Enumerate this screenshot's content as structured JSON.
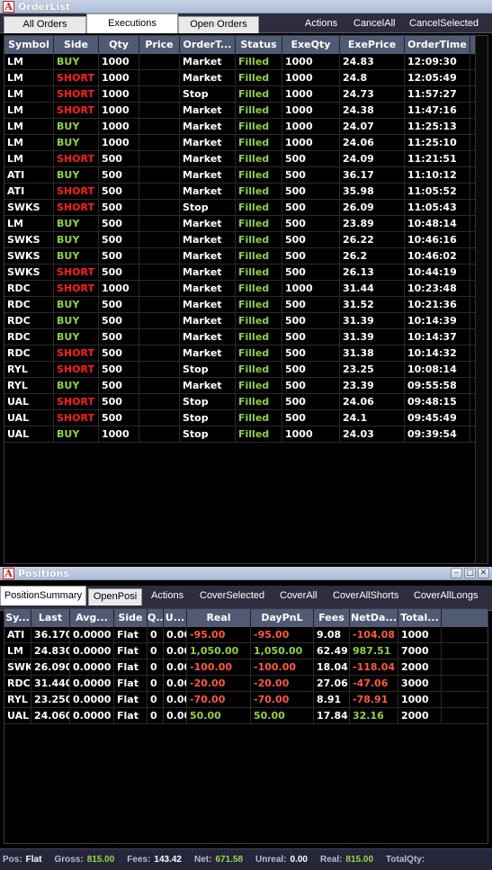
{
  "orders_window": {
    "title": "OrderList",
    "tabs": [
      "All Orders",
      "Executions",
      "Open Orders"
    ],
    "active_tab": 1,
    "actions": [
      "Actions",
      "CancelAll",
      "CancelSelected"
    ],
    "columns": [
      "Symbol",
      "Side",
      "Qty",
      "Price",
      "OrderT...",
      "Status",
      "ExeQty",
      "ExePrice",
      "OrderTime"
    ],
    "rows": [
      [
        "LM",
        "BUY",
        "1000",
        "",
        "Market",
        "Filled",
        "1000",
        "24.83",
        "12:09:30"
      ],
      [
        "LM",
        "SHORT",
        "1000",
        "",
        "Market",
        "Filled",
        "1000",
        "24.8",
        "12:05:49"
      ],
      [
        "LM",
        "SHORT",
        "1000",
        "",
        "Stop",
        "Filled",
        "1000",
        "24.73",
        "11:57:27"
      ],
      [
        "LM",
        "SHORT",
        "1000",
        "",
        "Market",
        "Filled",
        "1000",
        "24.38",
        "11:47:16"
      ],
      [
        "LM",
        "BUY",
        "1000",
        "",
        "Market",
        "Filled",
        "1000",
        "24.07",
        "11:25:13"
      ],
      [
        "LM",
        "BUY",
        "1000",
        "",
        "Market",
        "Filled",
        "1000",
        "24.06",
        "11:25:10"
      ],
      [
        "LM",
        "SHORT",
        "500",
        "",
        "Market",
        "Filled",
        "500",
        "24.09",
        "11:21:51"
      ],
      [
        "ATI",
        "BUY",
        "500",
        "",
        "Market",
        "Filled",
        "500",
        "36.17",
        "11:10:12"
      ],
      [
        "ATI",
        "SHORT",
        "500",
        "",
        "Market",
        "Filled",
        "500",
        "35.98",
        "11:05:52"
      ],
      [
        "SWKS",
        "SHORT",
        "500",
        "",
        "Stop",
        "Filled",
        "500",
        "26.09",
        "11:05:43"
      ],
      [
        "LM",
        "BUY",
        "500",
        "",
        "Market",
        "Filled",
        "500",
        "23.89",
        "10:48:14"
      ],
      [
        "SWKS",
        "BUY",
        "500",
        "",
        "Market",
        "Filled",
        "500",
        "26.22",
        "10:46:16"
      ],
      [
        "SWKS",
        "BUY",
        "500",
        "",
        "Market",
        "Filled",
        "500",
        "26.2",
        "10:46:02"
      ],
      [
        "SWKS",
        "SHORT",
        "500",
        "",
        "Market",
        "Filled",
        "500",
        "26.13",
        "10:44:19"
      ],
      [
        "RDC",
        "SHORT",
        "1000",
        "",
        "Market",
        "Filled",
        "1000",
        "31.44",
        "10:23:48"
      ],
      [
        "RDC",
        "BUY",
        "500",
        "",
        "Market",
        "Filled",
        "500",
        "31.52",
        "10:21:36"
      ],
      [
        "RDC",
        "BUY",
        "500",
        "",
        "Market",
        "Filled",
        "500",
        "31.39",
        "10:14:39"
      ],
      [
        "RDC",
        "BUY",
        "500",
        "",
        "Market",
        "Filled",
        "500",
        "31.39",
        "10:14:37"
      ],
      [
        "RDC",
        "SHORT",
        "500",
        "",
        "Market",
        "Filled",
        "500",
        "31.38",
        "10:14:32"
      ],
      [
        "RYL",
        "SHORT",
        "500",
        "",
        "Stop",
        "Filled",
        "500",
        "23.25",
        "10:08:14"
      ],
      [
        "RYL",
        "BUY",
        "500",
        "",
        "Market",
        "Filled",
        "500",
        "23.39",
        "09:55:58"
      ],
      [
        "UAL",
        "SHORT",
        "500",
        "",
        "Stop",
        "Filled",
        "500",
        "24.06",
        "09:48:15"
      ],
      [
        "UAL",
        "SHORT",
        "500",
        "",
        "Stop",
        "Filled",
        "500",
        "24.1",
        "09:45:49"
      ],
      [
        "UAL",
        "BUY",
        "1000",
        "",
        "Stop",
        "Filled",
        "1000",
        "24.03",
        "09:39:54"
      ]
    ]
  },
  "positions_window": {
    "title": "Positions",
    "tabs": [
      "PositionSummary",
      "OpenPosi"
    ],
    "active_tab": 0,
    "actions": [
      "Actions",
      "CoverSelected",
      "CoverAll",
      "CoverAllShorts",
      "CoverAllLongs"
    ],
    "columns": [
      "Sy...",
      "Last",
      "Avg...",
      "Side",
      "Q...",
      "U...",
      "Real",
      "DayPnL",
      "Fees",
      "NetDa...",
      "Total..."
    ],
    "rows": [
      [
        "ATI",
        "36.1700",
        "0.0000",
        "Flat",
        "0",
        "0.00",
        "-95.00",
        "-95.00",
        "9.08",
        "-104.08",
        "1000"
      ],
      [
        "LM",
        "24.8300",
        "0.0000",
        "Flat",
        "0",
        "0.00",
        "1,050.00",
        "1,050.00",
        "62.49",
        "987.51",
        "7000"
      ],
      [
        "SWKS",
        "26.0900",
        "0.0000",
        "Flat",
        "0",
        "0.00",
        "-100.00",
        "-100.00",
        "18.04",
        "-118.04",
        "2000"
      ],
      [
        "RDC",
        "31.4400",
        "0.0000",
        "Flat",
        "0",
        "0.00",
        "-20.00",
        "-20.00",
        "27.06",
        "-47.06",
        "3000"
      ],
      [
        "RYL",
        "23.2500",
        "0.0000",
        "Flat",
        "0",
        "0.00",
        "-70.00",
        "-70.00",
        "8.91",
        "-78.91",
        "1000"
      ],
      [
        "UAL",
        "24.0600",
        "0.0000",
        "Flat",
        "0",
        "0.00",
        "50.00",
        "50.00",
        "17.84",
        "32.16",
        "2000"
      ]
    ],
    "status": {
      "pos_label": "Pos:",
      "pos_value": "Flat",
      "gross_label": "Gross:",
      "gross_value": "815.00",
      "fees_label": "Fees:",
      "fees_value": "143.42",
      "net_label": "Net:",
      "net_value": "671.58",
      "unreal_label": "Unreal:",
      "unreal_value": "0.00",
      "real_label": "Real:",
      "real_value": "815.00",
      "totalqty_label": "TotalQty:"
    }
  },
  "colors": {
    "buy": "#8ed14a",
    "short": "#ff1e1e",
    "negative": "#ff5a3c",
    "header": "#505a72"
  },
  "icons": [
    "app-icon",
    "minimize-icon",
    "maximize-icon",
    "close-icon"
  ]
}
